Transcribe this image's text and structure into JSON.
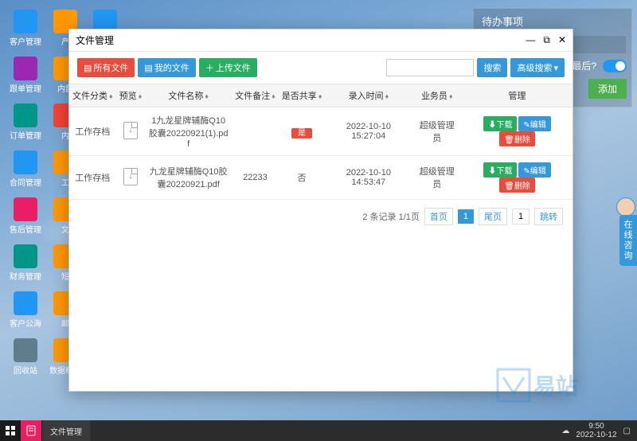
{
  "todo": {
    "title": "待办事项",
    "move_last": "动到最后?",
    "add": "添加"
  },
  "window": {
    "title": "文件管理",
    "toolbar": {
      "all_files": "所有文件",
      "my_files": "我的文件",
      "upload": "上传文件",
      "search": "搜索",
      "advanced": "高级搜索"
    },
    "columns": {
      "category": "文件分类",
      "preview": "预览",
      "filename": "文件名称",
      "notes": "文件备注",
      "shared": "是否共享",
      "time": "录入时间",
      "operator": "业务员",
      "manage": "管理"
    },
    "rows": [
      {
        "category": "工作存档",
        "filename": "1九龙星牌辅酶Q10胶囊20220921(1).pdf",
        "notes": "",
        "shared": "是",
        "shared_badge": true,
        "time": "2022-10-10 15:27:04",
        "operator": "超级管理员"
      },
      {
        "category": "工作存档",
        "filename": "九龙星牌辅酶Q10胶囊20220921.pdf",
        "notes": "22233",
        "shared": "否",
        "shared_badge": false,
        "time": "2022-10-10 14:53:47",
        "operator": "超级管理员"
      }
    ],
    "actions": {
      "download": "下载",
      "edit": "编辑",
      "delete": "删除"
    },
    "pager": {
      "summary": "2 条记录 1/1页",
      "first": "首页",
      "current": "1",
      "last": "尾页",
      "jump_val": "1",
      "jump": "跳转"
    }
  },
  "desktop": {
    "icons": [
      [
        {
          "label": "客户管理",
          "c": "c-blue"
        },
        {
          "label": "产",
          "c": "c-orange"
        },
        {
          "label": "",
          "c": "c-blue"
        }
      ],
      [
        {
          "label": "跟单管理",
          "c": "c-purple"
        },
        {
          "label": "内部",
          "c": "c-orange"
        }
      ],
      [
        {
          "label": "订单管理",
          "c": "c-teal"
        },
        {
          "label": "内",
          "c": "c-red"
        }
      ],
      [
        {
          "label": "合同管理",
          "c": "c-blue"
        },
        {
          "label": "工",
          "c": "c-orange"
        }
      ],
      [
        {
          "label": "售后管理",
          "c": "c-pink"
        },
        {
          "label": "文",
          "c": "c-orange"
        }
      ],
      [
        {
          "label": "财务管理",
          "c": "c-teal"
        },
        {
          "label": "短",
          "c": "c-orange"
        }
      ],
      [
        {
          "label": "客户公海",
          "c": "c-blue"
        },
        {
          "label": "邮",
          "c": "c-orange"
        }
      ],
      [
        {
          "label": "回收站",
          "c": "c-gray"
        },
        {
          "label": "数据概况",
          "c": "c-orange"
        }
      ]
    ]
  },
  "consult": "在线咨询",
  "watermark": "易站",
  "taskbar": {
    "app": "文件管理",
    "time": "9:50",
    "date": "2022-10-12"
  }
}
